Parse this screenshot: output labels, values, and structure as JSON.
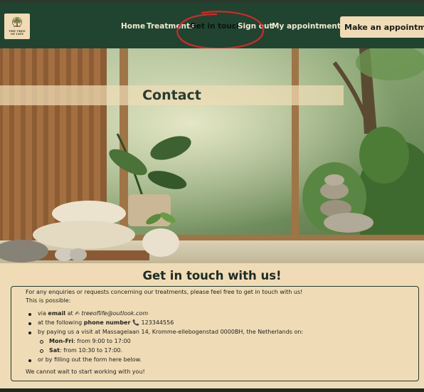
{
  "brand": {
    "logo_line1": "THE TREE",
    "logo_line2": "OF LIFE"
  },
  "nav": {
    "items": [
      {
        "label": "Home"
      },
      {
        "label": "Treatments"
      },
      {
        "label": "Get in touch"
      },
      {
        "label": "Sign out"
      },
      {
        "label": "My appointments"
      }
    ],
    "active_index": 2,
    "cta_label": "Make an appointment"
  },
  "hero": {
    "title": "Contact"
  },
  "contact": {
    "heading": "Get in touch with us!",
    "intro": "For any enquiries or requests concerning our treatments, please feel free to get in touch with us!",
    "possible": "This is possible:",
    "email_prefix": "via ",
    "email_label": "email",
    "email_at": " at ",
    "email_icon": "✍",
    "email_value": "treeoflife@outlook.com",
    "phone_prefix": "at the following ",
    "phone_label": "phone number",
    "phone_icon": "📞",
    "phone_value": "123344556",
    "visit_text": "by paying us a visit at Massagelaan 14, Kromme-ellebogenstad 0000BH, the Netherlands on:",
    "hours": [
      {
        "days": "Mon-Fri",
        "time": ": from 9:00 to 17:00"
      },
      {
        "days": "Sat",
        "time": ": from 10:30 to 17:00."
      }
    ],
    "form_text": "or by filling out the form here below.",
    "closing": "We cannot wait to start working with you!"
  },
  "colors": {
    "header": "#204430",
    "beige": "#efdcb6",
    "annotation": "#d8262b"
  }
}
